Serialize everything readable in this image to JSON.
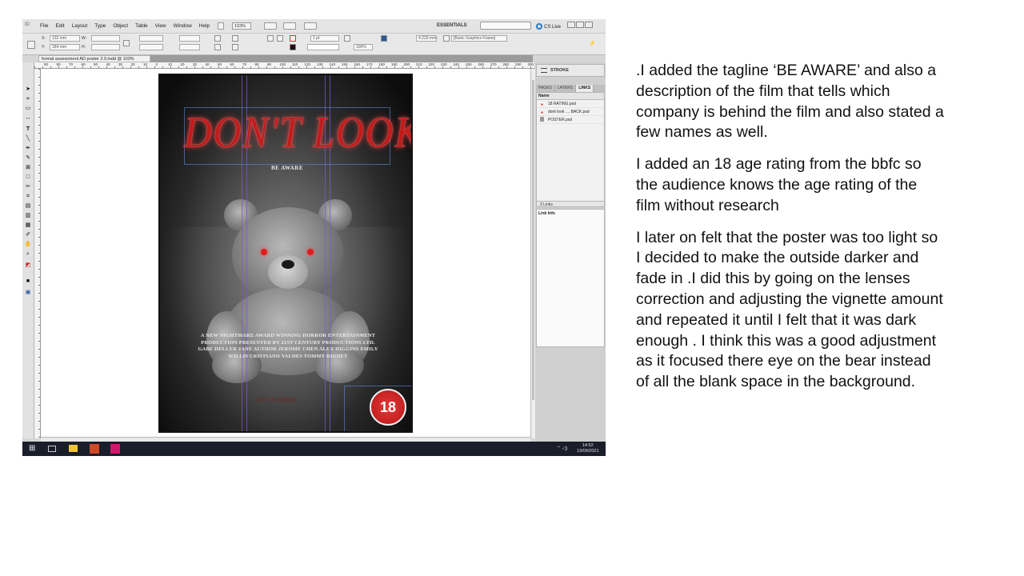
{
  "menubar": {
    "app_badge": "ID",
    "menus": [
      "File",
      "Edit",
      "Layout",
      "Type",
      "Object",
      "Table",
      "View",
      "Window",
      "Help"
    ],
    "zoom": "103%",
    "workspace": "ESSENTIALS",
    "cs_live": "CS Live"
  },
  "control": {
    "x_label": "X:",
    "x_value": "132 mm",
    "y_label": "Y:",
    "y_value": "184 mm",
    "w_label": "W:",
    "h_label": "H:",
    "stroke_weight": "1 pt",
    "opacity": "100%",
    "offset": "4.233 mm",
    "frame_style": "[Basic Graphics Frame]"
  },
  "document": {
    "tab_title": "formal assessment AD poster 2.0.indd @ 103%",
    "ruler_marks": [
      "90",
      "80",
      "70",
      "60",
      "50",
      "40",
      "30",
      "20",
      "10",
      "0",
      "10",
      "20",
      "30",
      "40",
      "50",
      "60",
      "70",
      "80",
      "90",
      "100",
      "110",
      "120",
      "130",
      "140",
      "150",
      "160",
      "170",
      "180",
      "190",
      "200",
      "210",
      "220",
      "230",
      "240",
      "250",
      "260",
      "270",
      "280",
      "290",
      "300"
    ]
  },
  "poster": {
    "title": "DON'T LOOK",
    "tagline": "BE AWARE",
    "credits": "A NEW NIGHTMARE AWARD WINNING HORROR ENTERTAINMENT PRODUCTION PRESENTED BY 21ST CENTURY PRODUCTIONS LTD. GABE HELLER JANE AUTHOR JEROME CHEN ALEX HIGGINS EMILY WILLIS CRISTIANO VALDES TOMMY RIGNET",
    "release": "21ST OCTOBER",
    "rating": "18"
  },
  "panels": {
    "stroke": "STROKE",
    "tabs": [
      "PAGES",
      "LAYERS",
      "LINKS"
    ],
    "links_header": "Name",
    "links": [
      "18 RATING.psd",
      "dont look .... BACK.psd",
      "POSTER.psd"
    ],
    "links_count": "3 Links",
    "link_info": "Link Info"
  },
  "taskbar": {
    "time": "14:52",
    "date": "13/09/2021"
  },
  "notes": [
    ".I added the tagline ‘BE AWARE’ and also a description of the film that tells which company is behind the film and also stated a few  names as well.",
    "I added an 18 age rating from the bbfc so the audience knows the age rating of the film without research",
    "I later on felt that the poster was too light so I decided to make the outside darker and fade in .I did this by going on the lenses correction and adjusting the vignette amount and repeated it until I felt that it was dark enough . I think this was a good adjustment as it focused there eye on the bear instead of all the blank space in the background."
  ],
  "colors": {
    "title_red": "#c21b1b",
    "guide_purple": "#785ad2",
    "taskbar": "#1a1d2a"
  }
}
